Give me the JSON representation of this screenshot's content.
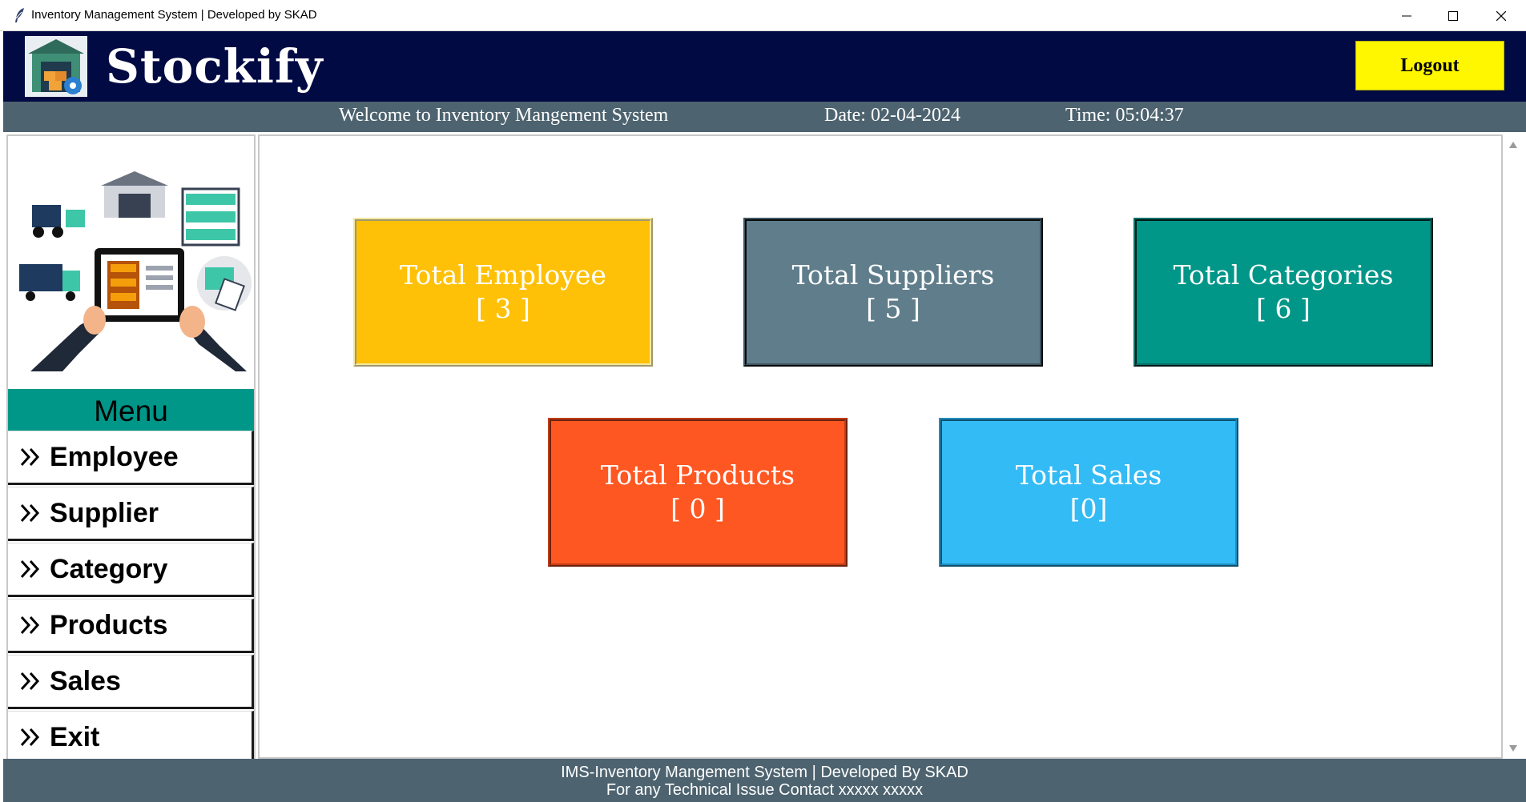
{
  "window": {
    "title": "Inventory Management System | Developed by SKAD",
    "icon": "feather-icon",
    "controls": [
      "minimize-icon",
      "maximize-icon",
      "close-icon"
    ]
  },
  "header": {
    "brand": "Stockify",
    "logo": "warehouse-logo",
    "logout_label": "Logout"
  },
  "infobar": {
    "welcome": "Welcome to Inventory Mangement System",
    "date": "Date: 02-04-2024",
    "time": "Time: 05:04:37"
  },
  "menu": {
    "title": "Menu",
    "items": [
      {
        "label": "Employee"
      },
      {
        "label": "Supplier"
      },
      {
        "label": "Category"
      },
      {
        "label": "Products"
      },
      {
        "label": "Sales"
      },
      {
        "label": "Exit"
      }
    ]
  },
  "cards": {
    "employee": {
      "title": "Total Employee",
      "value": "[ 3 ]"
    },
    "suppliers": {
      "title": "Total Suppliers",
      "value": "[ 5 ]"
    },
    "categories": {
      "title": "Total Categories",
      "value": "[ 6 ]"
    },
    "products": {
      "title": "Total Products",
      "value": "[ 0 ]"
    },
    "sales": {
      "title": "Total Sales",
      "value": "[0]"
    }
  },
  "footer": {
    "line1": "IMS-Inventory Mangement System | Developed By SKAD",
    "line2": "For any Technical Issue Contact xxxxx xxxxx"
  },
  "colors": {
    "header_bg": "#010a43",
    "bar_bg": "#4d636f",
    "logout_bg": "#fff700",
    "menu_title_bg": "#009688",
    "employee": "#ffc107",
    "suppliers": "#607d8b",
    "categories": "#009688",
    "products": "#ff5722",
    "sales": "#33bbf5"
  }
}
